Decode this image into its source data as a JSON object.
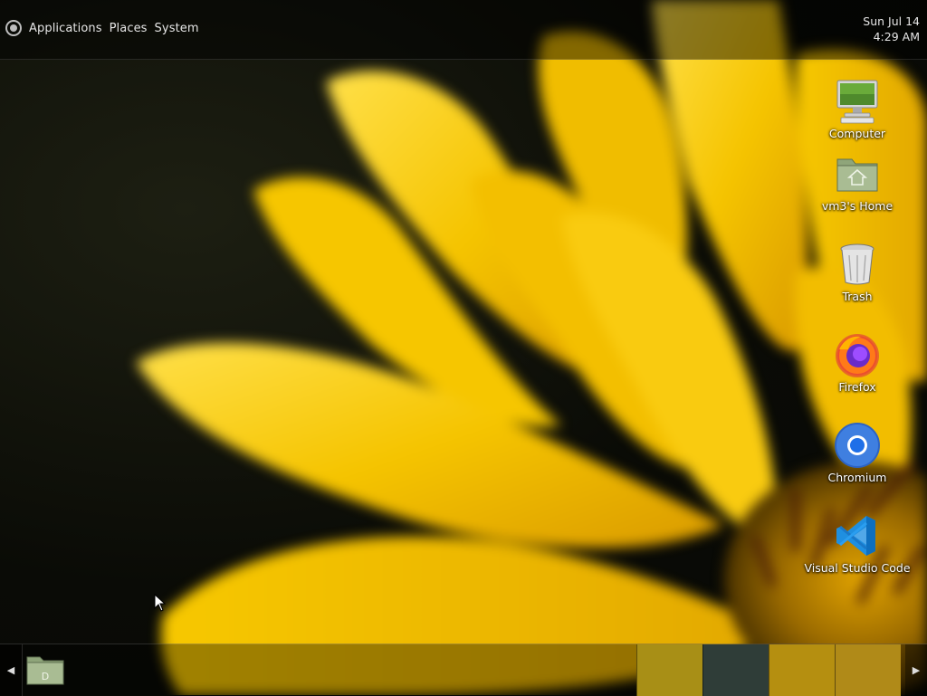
{
  "top_panel": {
    "menu": {
      "applications": "Applications",
      "places": "Places",
      "system": "System"
    },
    "clock": {
      "date": "Sun Jul 14",
      "time": "4:29 AM"
    }
  },
  "desktop_icons": [
    {
      "label": "Computer",
      "icon": "computer-icon"
    },
    {
      "label": "vm3's Home",
      "icon": "home-folder-icon"
    },
    {
      "label": "Trash",
      "icon": "trash-icon"
    },
    {
      "label": "Firefox",
      "icon": "firefox-icon"
    },
    {
      "label": "Chromium",
      "icon": "chromium-icon"
    },
    {
      "label": "Visual Studio Code",
      "icon": "vscode-icon"
    }
  ],
  "bottom_panel": {
    "left_arrow": "◀",
    "right_arrow": "▶",
    "launcher_icon": "folder-icon",
    "workspace_colors": [
      "#a88f16",
      "#2f3d38",
      "#b58f10",
      "#b08a18"
    ]
  },
  "colors": {
    "petal": "#f2c200",
    "petal_light": "#ffd936",
    "background_dark": "#0b0c07"
  }
}
